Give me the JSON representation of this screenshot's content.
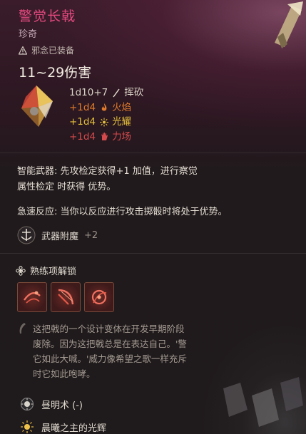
{
  "item": {
    "title": "警觉长戟",
    "rarity": "珍奇",
    "equip_status": "邪念已装备",
    "damage_summary": "11~29伤害",
    "damage_lines": [
      {
        "dice": "1d10+7",
        "type": "挥砍",
        "color": "#d9d2c7"
      },
      {
        "dice": "+1d4",
        "type": "火焰",
        "color": "#e07a2c"
      },
      {
        "dice": "+1d4",
        "type": "光耀",
        "color": "#e3bf3c"
      },
      {
        "dice": "+1d4",
        "type": "力场",
        "color": "#d44a4c"
      }
    ],
    "passives": [
      {
        "text_line1": "智能武器: 先攻检定获得+1 加值，进行察觉",
        "text_line2": "属性检定 时获得 优势。"
      },
      {
        "text": "急速反应: 当你以反应进行攻击掷骰时将处于优势。"
      }
    ],
    "enchantment": {
      "label": "武器附魔",
      "bonus": "+2"
    }
  },
  "proficiency": {
    "heading": "熟练项解锁",
    "actions": [
      "action-1",
      "action-2",
      "action-3"
    ]
  },
  "lore": {
    "line1": "这把戟的一个设计变体在开发早期阶段",
    "line2": "废除。因为这把戟总是在表达自己。'警",
    "line3": "它如此大喊。'威力像希望之歌一样充斥",
    "line4": "时它如此咆哮。"
  },
  "conditions": [
    {
      "label": "昼明术 (-)",
      "icon": "sun-dark-icon"
    },
    {
      "label": "晨曦之主的光辉",
      "icon": "sun-bright-icon"
    }
  ],
  "colors": {
    "title": "#e0487d",
    "fire": "#e07a2c",
    "radiant": "#e3bf3c",
    "force": "#d44a4c"
  }
}
